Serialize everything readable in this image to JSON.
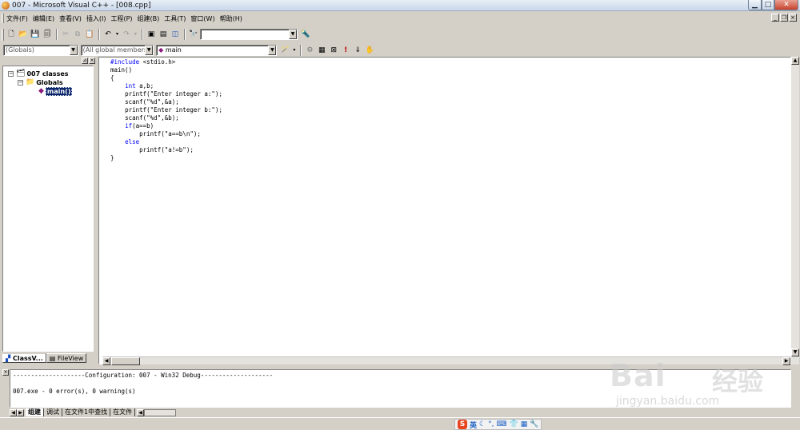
{
  "window": {
    "title": "007 - Microsoft Visual C++ - [008.cpp]"
  },
  "menubar": {
    "items": [
      "文件(F)",
      "编辑(E)",
      "查看(V)",
      "插入(I)",
      "工程(P)",
      "组建(B)",
      "工具(T)",
      "窗口(W)",
      "帮助(H)"
    ]
  },
  "toolbar": {
    "find_combo_value": "",
    "undo_icon": "undo-icon",
    "redo_icon": "redo-icon"
  },
  "wizardbar": {
    "class_combo": "(Globals)",
    "filter_combo": "(All global members",
    "members_combo": "main"
  },
  "workspace": {
    "root_label": "007 classes",
    "folder_label": "Globals",
    "item_label": "main()",
    "tabs": [
      "ClassV...",
      "FileView"
    ]
  },
  "editor": {
    "lines": [
      {
        "kw": "#include",
        "rest": " <stdio.h>",
        "indent": ""
      },
      {
        "kw": "",
        "rest": "main()",
        "indent": ""
      },
      {
        "kw": "",
        "rest": "{",
        "indent": ""
      },
      {
        "kw": "int",
        "rest": " a,b;",
        "indent": "    "
      },
      {
        "kw": "",
        "rest": "printf(\"Enter integer a:\");",
        "indent": "    "
      },
      {
        "kw": "",
        "rest": "scanf(\"%d\",&a);",
        "indent": "    "
      },
      {
        "kw": "",
        "rest": "printf(\"Enter integer b:\");",
        "indent": "    "
      },
      {
        "kw": "",
        "rest": "scanf(\"%d\",&b);",
        "indent": "    "
      },
      {
        "kw": "if",
        "rest": "(a==b)",
        "indent": "    "
      },
      {
        "kw": "",
        "rest": "printf(\"a==b\\n\");",
        "indent": "        "
      },
      {
        "kw": "else",
        "rest": "",
        "indent": "    "
      },
      {
        "kw": "",
        "rest": "printf(\"a!=b\");",
        "indent": "        "
      },
      {
        "kw": "",
        "rest": "}",
        "indent": ""
      }
    ]
  },
  "output": {
    "config_line": "--------------------Configuration: 007 - Win32 Debug--------------------",
    "blank": "",
    "result_line": "007.exe - 0 error(s), 0 warning(s)",
    "tabs": [
      "组建",
      "调试",
      "在文件1中查找",
      "在文件"
    ]
  },
  "ime": {
    "lang": "英"
  },
  "watermark": {
    "brand": "Bai",
    "cn": "经验",
    "url": "jingyan.baidu.com"
  }
}
